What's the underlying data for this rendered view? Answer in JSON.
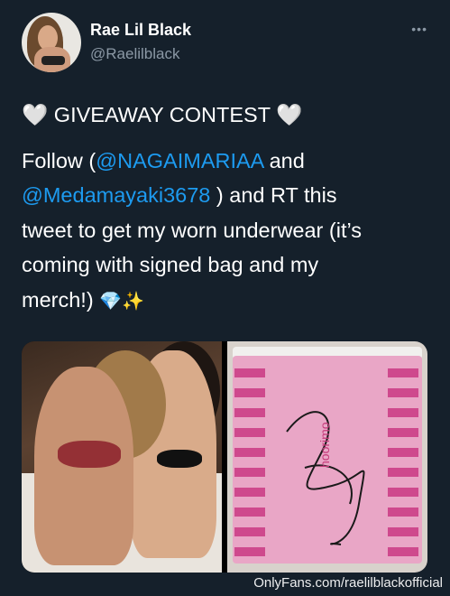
{
  "user": {
    "name": "Rae Lil Black",
    "handle": "@Raelilblack"
  },
  "more_menu": "•••",
  "tweet": {
    "title": "GIVEAWAY CONTEST",
    "line1_prefix": "Follow (",
    "mention1": "@NAGAIMARIAA",
    "line1_suffix": " and",
    "mention2": "@Medamayaki3678",
    "line2_suffix": " ) and RT this",
    "line3": "tweet to get my worn underwear (it’s",
    "line4": "coming with signed bag and my",
    "line5": "merch!)"
  },
  "icons": {
    "heart": "🤍",
    "gem": "💎",
    "sparkles": "✨"
  },
  "media": {
    "brand_text": "hoorimo"
  },
  "watermark": "OnlyFans.com/raelilblackofficial",
  "colors": {
    "background": "#15202b",
    "mention": "#1d9bf0",
    "secondary": "#8b98a5"
  }
}
